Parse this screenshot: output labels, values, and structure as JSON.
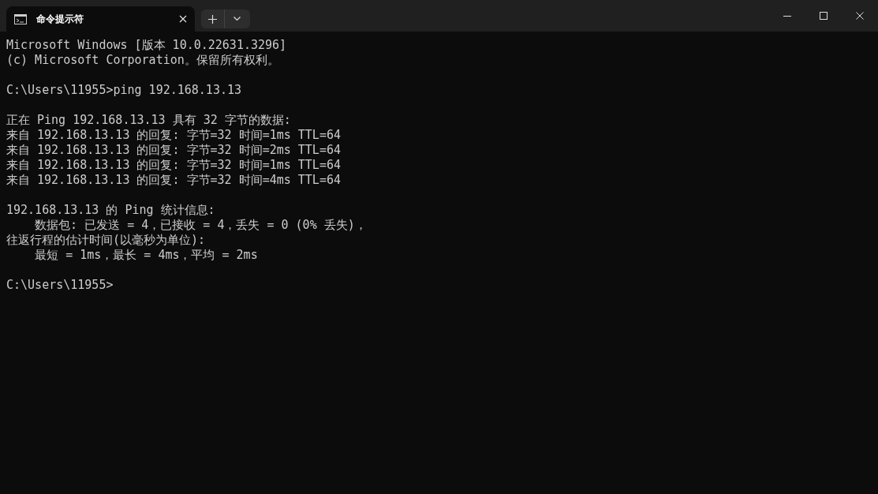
{
  "tab": {
    "title": "命令提示符",
    "selected": true
  },
  "blocks": [
    [
      "Microsoft Windows [版本 10.0.22631.3296]",
      "(c) Microsoft Corporation。保留所有权利。"
    ],
    [
      "C:\\Users\\11955>ping 192.168.13.13"
    ],
    [
      "正在 Ping 192.168.13.13 具有 32 字节的数据:",
      "来自 192.168.13.13 的回复: 字节=32 时间=1ms TTL=64",
      "来自 192.168.13.13 的回复: 字节=32 时间=2ms TTL=64",
      "来自 192.168.13.13 的回复: 字节=32 时间=1ms TTL=64",
      "来自 192.168.13.13 的回复: 字节=32 时间=4ms TTL=64"
    ],
    [
      "192.168.13.13 的 Ping 统计信息:",
      "    数据包: 已发送 = 4，已接收 = 4，丢失 = 0 (0% 丢失)，",
      "往返行程的估计时间(以毫秒为单位):",
      "    最短 = 1ms，最长 = 4ms，平均 = 2ms"
    ],
    [
      "C:\\Users\\11955>"
    ]
  ]
}
